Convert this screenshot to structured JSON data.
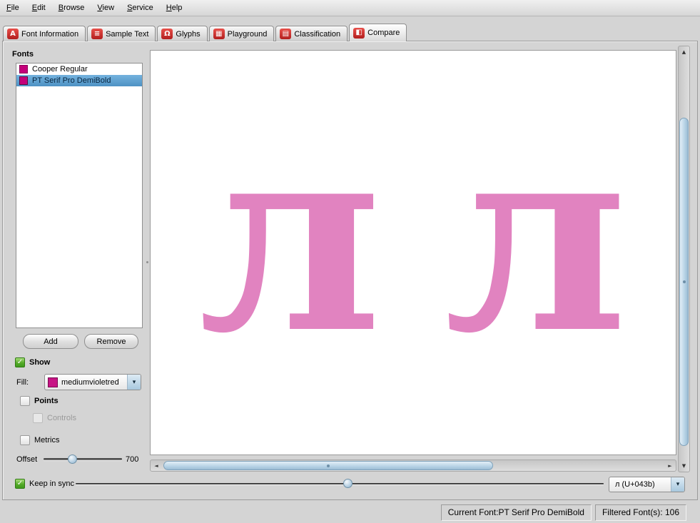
{
  "colors": {
    "font_swatch": "#c4007a",
    "fill_swatch": "#c71585",
    "glyph_fill": "#e183c0",
    "selection_blue": "#4e92c4",
    "checkbox_green": "#3f9a1d"
  },
  "icons": {
    "check": "✓",
    "dropdown": "▾",
    "scroll_up": "▲",
    "scroll_down": "▼",
    "scroll_left": "◄",
    "scroll_right": "►",
    "tab_font_information": "A",
    "tab_sample_text": "≡",
    "tab_glyphs": "Ω",
    "tab_playground": "▦",
    "tab_classification": "▤",
    "tab_compare": "◧"
  },
  "menu": {
    "items": [
      "File",
      "Edit",
      "Browse",
      "View",
      "Service",
      "Help"
    ]
  },
  "tabs": [
    {
      "label": "Font Information",
      "active": false
    },
    {
      "label": "Sample Text",
      "active": false
    },
    {
      "label": "Glyphs",
      "active": false
    },
    {
      "label": "Playground",
      "active": false
    },
    {
      "label": "Classification",
      "active": false
    },
    {
      "label": "Compare",
      "active": true
    }
  ],
  "sidebar": {
    "title": "Fonts",
    "fonts": [
      {
        "name": "Cooper Regular",
        "selected": false
      },
      {
        "name": "PT Serif Pro DemiBold",
        "selected": true
      }
    ],
    "add_label": "Add",
    "remove_label": "Remove",
    "show_label": "Show",
    "show_checked": true,
    "fill_label": "Fill:",
    "fill_value": "mediumvioletred",
    "points_label": "Points",
    "points_checked": false,
    "controls_label": "Controls",
    "controls_checked": false,
    "controls_enabled": false,
    "metrics_label": "Metrics",
    "metrics_checked": false,
    "offset_label": "Offset",
    "offset_value": "700"
  },
  "canvas": {
    "glyphs": [
      "л",
      "л"
    ]
  },
  "bottom_bar": {
    "keep_in_sync_label": "Keep in sync",
    "keep_in_sync_checked": true,
    "glyph_combo_value": "л (U+043b)"
  },
  "status_bar": {
    "current_font": "Current Font:PT Serif Pro DemiBold",
    "filtered_fonts": "Filtered Font(s): 106"
  }
}
